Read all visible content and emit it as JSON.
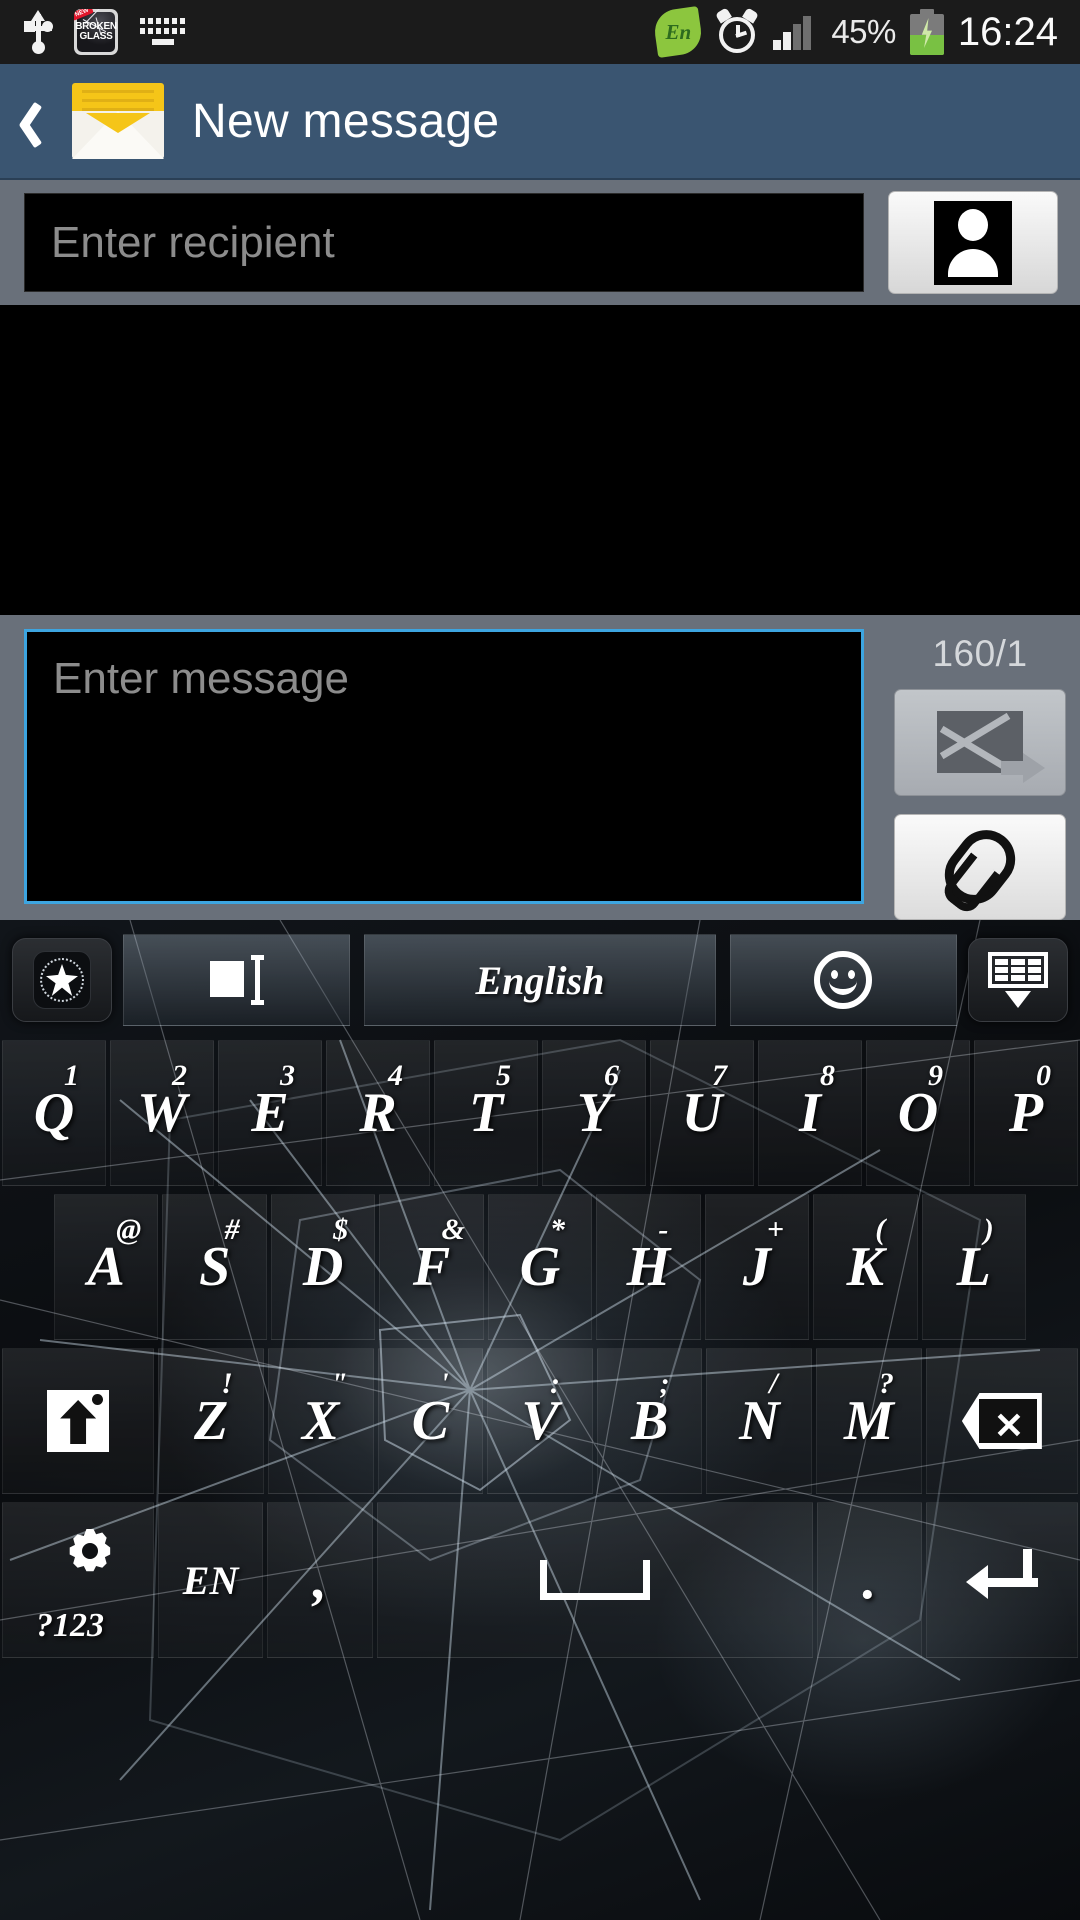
{
  "status_bar": {
    "usb_icon": "usb-icon",
    "app_icon_label": "BROKEN GLASS",
    "app_icon_badge": "NEW",
    "keyboard_icon": "keyboard-icon",
    "language_badge": "En",
    "alarm_icon": "alarm-clock-icon",
    "signal_icon": "signal-bars-icon",
    "battery_percent": "45%",
    "battery_icon": "battery-charging-icon",
    "time": "16:24"
  },
  "title_bar": {
    "back_icon": "back-chevron-icon",
    "app_icon": "envelope-icon",
    "title": "New message"
  },
  "recipient": {
    "placeholder": "Enter recipient",
    "value": "",
    "contact_button_icon": "contact-person-icon"
  },
  "compose": {
    "placeholder": "Enter message",
    "value": "",
    "char_counter": "160/1",
    "send_button_icon": "send-message-icon",
    "attach_button_icon": "paperclip-icon",
    "focus_border_color": "#3da5e0"
  },
  "keyboard": {
    "toolbar": {
      "theme_icon": "keyboard-theme-icon",
      "clipboard_icon": "clipboard-icon",
      "language_label": "English",
      "emoji_icon": "emoji-smiley-icon",
      "hide_icon": "hide-keyboard-icon"
    },
    "row1": [
      {
        "main": "Q",
        "sup": "1"
      },
      {
        "main": "W",
        "sup": "2"
      },
      {
        "main": "E",
        "sup": "3"
      },
      {
        "main": "R",
        "sup": "4"
      },
      {
        "main": "T",
        "sup": "5"
      },
      {
        "main": "Y",
        "sup": "6"
      },
      {
        "main": "U",
        "sup": "7"
      },
      {
        "main": "I",
        "sup": "8"
      },
      {
        "main": "O",
        "sup": "9"
      },
      {
        "main": "P",
        "sup": "0"
      }
    ],
    "row2": [
      {
        "main": "A",
        "sup": "@"
      },
      {
        "main": "S",
        "sup": "#"
      },
      {
        "main": "D",
        "sup": "$"
      },
      {
        "main": "F",
        "sup": "&"
      },
      {
        "main": "G",
        "sup": "*"
      },
      {
        "main": "H",
        "sup": "-"
      },
      {
        "main": "J",
        "sup": "+"
      },
      {
        "main": "K",
        "sup": "("
      },
      {
        "main": "L",
        "sup": ")"
      }
    ],
    "row3": [
      {
        "main": "Z",
        "sup": "!"
      },
      {
        "main": "X",
        "sup": "\""
      },
      {
        "main": "C",
        "sup": "'"
      },
      {
        "main": "V",
        "sup": ":"
      },
      {
        "main": "B",
        "sup": ";"
      },
      {
        "main": "N",
        "sup": "/"
      },
      {
        "main": "M",
        "sup": "?"
      }
    ],
    "shift_key": "shift-icon",
    "backspace_key": "backspace-icon",
    "row4": {
      "symbols_label": "?123",
      "symbols_icon": "gear-icon",
      "language_key": "EN",
      "comma_key": ",",
      "space_key": "space-icon",
      "period_key": ".",
      "enter_key": "enter-icon"
    }
  }
}
